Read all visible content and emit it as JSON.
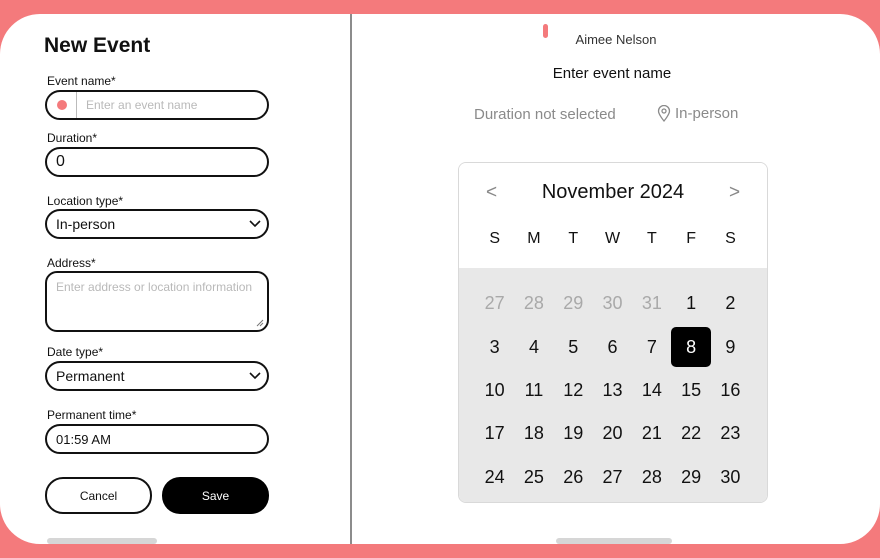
{
  "form": {
    "title": "New Event",
    "event_name": {
      "label": "Event name*",
      "placeholder": "Enter an event name",
      "value": ""
    },
    "duration": {
      "label": "Duration*",
      "value": "0"
    },
    "location_type": {
      "label": "Location type*",
      "value": "In-person"
    },
    "address": {
      "label": "Address*",
      "placeholder": "Enter address or location information"
    },
    "date_type": {
      "label": "Date type*",
      "value": "Permanent"
    },
    "permanent_time": {
      "label": "Permanent time*",
      "value": "01:59 AM"
    },
    "cancel_label": "Cancel",
    "save_label": "Save"
  },
  "preview": {
    "host": "Aimee Nelson",
    "event_name": "Enter event name",
    "duration": "Duration not selected",
    "location": "In-person"
  },
  "calendar": {
    "month_label": "November 2024",
    "prev": "<",
    "next": ">",
    "weekdays": [
      "S",
      "M",
      "T",
      "W",
      "T",
      "F",
      "S"
    ],
    "days": [
      {
        "d": "27",
        "muted": true
      },
      {
        "d": "28",
        "muted": true
      },
      {
        "d": "29",
        "muted": true
      },
      {
        "d": "30",
        "muted": true
      },
      {
        "d": "31",
        "muted": true
      },
      {
        "d": "1"
      },
      {
        "d": "2"
      },
      {
        "d": "3"
      },
      {
        "d": "4"
      },
      {
        "d": "5"
      },
      {
        "d": "6"
      },
      {
        "d": "7"
      },
      {
        "d": "8",
        "selected": true
      },
      {
        "d": "9"
      },
      {
        "d": "10"
      },
      {
        "d": "11"
      },
      {
        "d": "12"
      },
      {
        "d": "13"
      },
      {
        "d": "14"
      },
      {
        "d": "15"
      },
      {
        "d": "16"
      },
      {
        "d": "17"
      },
      {
        "d": "18"
      },
      {
        "d": "19"
      },
      {
        "d": "20"
      },
      {
        "d": "21"
      },
      {
        "d": "22"
      },
      {
        "d": "23"
      },
      {
        "d": "24"
      },
      {
        "d": "25"
      },
      {
        "d": "26"
      },
      {
        "d": "27"
      },
      {
        "d": "28"
      },
      {
        "d": "29"
      },
      {
        "d": "30"
      }
    ]
  },
  "colors": {
    "accent": "#f47a7c",
    "selected_day": "#000000"
  }
}
